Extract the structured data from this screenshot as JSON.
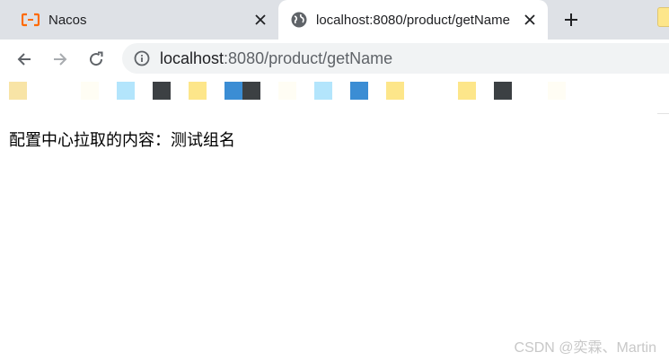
{
  "tabs": [
    {
      "title": "Nacos",
      "active": false,
      "favicon": "alibaba-cloud-icon"
    },
    {
      "title": "localhost:8080/product/getName",
      "active": true,
      "favicon": "globe-icon"
    }
  ],
  "toolbar": {
    "url_host": "localhost",
    "url_path": ":8080/product/getName",
    "icons": [
      "back-arrow-icon",
      "forward-arrow-icon",
      "reload-icon",
      "info-icon"
    ]
  },
  "bookmark_colors": [
    "#f8e4a6",
    "#fffdf4",
    "#b3e5fc",
    "#3c4043",
    "#fde68a",
    "#3b8dd4",
    "#3c4043",
    "#fffdf4",
    "#b3e5fc",
    "#3b8dd4",
    "#fde68a",
    "#fde68a",
    "#3c4043",
    "#fffdf4"
  ],
  "page": {
    "content": "配置中心拉取的内容：测试组名"
  },
  "watermark": "CSDN @奕霖、Martin",
  "colors": {
    "tabstrip": "#dee1e6",
    "omnibox": "#f1f3f4",
    "nacos_orange": "#ff6a00"
  }
}
